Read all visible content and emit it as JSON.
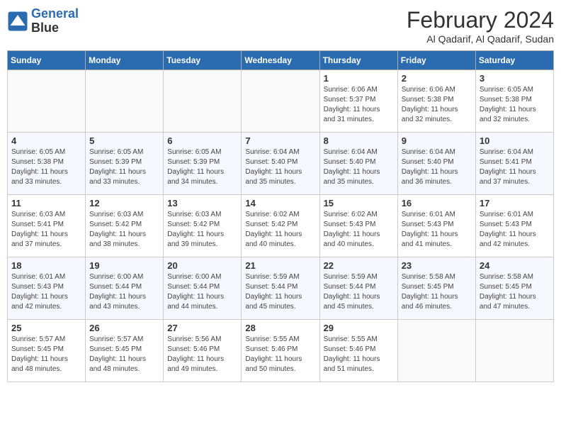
{
  "logo": {
    "line1": "General",
    "line2": "Blue"
  },
  "title": "February 2024",
  "location": "Al Qadarif, Al Qadarif, Sudan",
  "weekdays": [
    "Sunday",
    "Monday",
    "Tuesday",
    "Wednesday",
    "Thursday",
    "Friday",
    "Saturday"
  ],
  "weeks": [
    [
      {
        "day": "",
        "info": ""
      },
      {
        "day": "",
        "info": ""
      },
      {
        "day": "",
        "info": ""
      },
      {
        "day": "",
        "info": ""
      },
      {
        "day": "1",
        "info": "Sunrise: 6:06 AM\nSunset: 5:37 PM\nDaylight: 11 hours and 31 minutes."
      },
      {
        "day": "2",
        "info": "Sunrise: 6:06 AM\nSunset: 5:38 PM\nDaylight: 11 hours and 32 minutes."
      },
      {
        "day": "3",
        "info": "Sunrise: 6:05 AM\nSunset: 5:38 PM\nDaylight: 11 hours and 32 minutes."
      }
    ],
    [
      {
        "day": "4",
        "info": "Sunrise: 6:05 AM\nSunset: 5:38 PM\nDaylight: 11 hours and 33 minutes."
      },
      {
        "day": "5",
        "info": "Sunrise: 6:05 AM\nSunset: 5:39 PM\nDaylight: 11 hours and 33 minutes."
      },
      {
        "day": "6",
        "info": "Sunrise: 6:05 AM\nSunset: 5:39 PM\nDaylight: 11 hours and 34 minutes."
      },
      {
        "day": "7",
        "info": "Sunrise: 6:04 AM\nSunset: 5:40 PM\nDaylight: 11 hours and 35 minutes."
      },
      {
        "day": "8",
        "info": "Sunrise: 6:04 AM\nSunset: 5:40 PM\nDaylight: 11 hours and 35 minutes."
      },
      {
        "day": "9",
        "info": "Sunrise: 6:04 AM\nSunset: 5:40 PM\nDaylight: 11 hours and 36 minutes."
      },
      {
        "day": "10",
        "info": "Sunrise: 6:04 AM\nSunset: 5:41 PM\nDaylight: 11 hours and 37 minutes."
      }
    ],
    [
      {
        "day": "11",
        "info": "Sunrise: 6:03 AM\nSunset: 5:41 PM\nDaylight: 11 hours and 37 minutes."
      },
      {
        "day": "12",
        "info": "Sunrise: 6:03 AM\nSunset: 5:42 PM\nDaylight: 11 hours and 38 minutes."
      },
      {
        "day": "13",
        "info": "Sunrise: 6:03 AM\nSunset: 5:42 PM\nDaylight: 11 hours and 39 minutes."
      },
      {
        "day": "14",
        "info": "Sunrise: 6:02 AM\nSunset: 5:42 PM\nDaylight: 11 hours and 40 minutes."
      },
      {
        "day": "15",
        "info": "Sunrise: 6:02 AM\nSunset: 5:43 PM\nDaylight: 11 hours and 40 minutes."
      },
      {
        "day": "16",
        "info": "Sunrise: 6:01 AM\nSunset: 5:43 PM\nDaylight: 11 hours and 41 minutes."
      },
      {
        "day": "17",
        "info": "Sunrise: 6:01 AM\nSunset: 5:43 PM\nDaylight: 11 hours and 42 minutes."
      }
    ],
    [
      {
        "day": "18",
        "info": "Sunrise: 6:01 AM\nSunset: 5:43 PM\nDaylight: 11 hours and 42 minutes."
      },
      {
        "day": "19",
        "info": "Sunrise: 6:00 AM\nSunset: 5:44 PM\nDaylight: 11 hours and 43 minutes."
      },
      {
        "day": "20",
        "info": "Sunrise: 6:00 AM\nSunset: 5:44 PM\nDaylight: 11 hours and 44 minutes."
      },
      {
        "day": "21",
        "info": "Sunrise: 5:59 AM\nSunset: 5:44 PM\nDaylight: 11 hours and 45 minutes."
      },
      {
        "day": "22",
        "info": "Sunrise: 5:59 AM\nSunset: 5:44 PM\nDaylight: 11 hours and 45 minutes."
      },
      {
        "day": "23",
        "info": "Sunrise: 5:58 AM\nSunset: 5:45 PM\nDaylight: 11 hours and 46 minutes."
      },
      {
        "day": "24",
        "info": "Sunrise: 5:58 AM\nSunset: 5:45 PM\nDaylight: 11 hours and 47 minutes."
      }
    ],
    [
      {
        "day": "25",
        "info": "Sunrise: 5:57 AM\nSunset: 5:45 PM\nDaylight: 11 hours and 48 minutes."
      },
      {
        "day": "26",
        "info": "Sunrise: 5:57 AM\nSunset: 5:45 PM\nDaylight: 11 hours and 48 minutes."
      },
      {
        "day": "27",
        "info": "Sunrise: 5:56 AM\nSunset: 5:46 PM\nDaylight: 11 hours and 49 minutes."
      },
      {
        "day": "28",
        "info": "Sunrise: 5:55 AM\nSunset: 5:46 PM\nDaylight: 11 hours and 50 minutes."
      },
      {
        "day": "29",
        "info": "Sunrise: 5:55 AM\nSunset: 5:46 PM\nDaylight: 11 hours and 51 minutes."
      },
      {
        "day": "",
        "info": ""
      },
      {
        "day": "",
        "info": ""
      }
    ]
  ]
}
